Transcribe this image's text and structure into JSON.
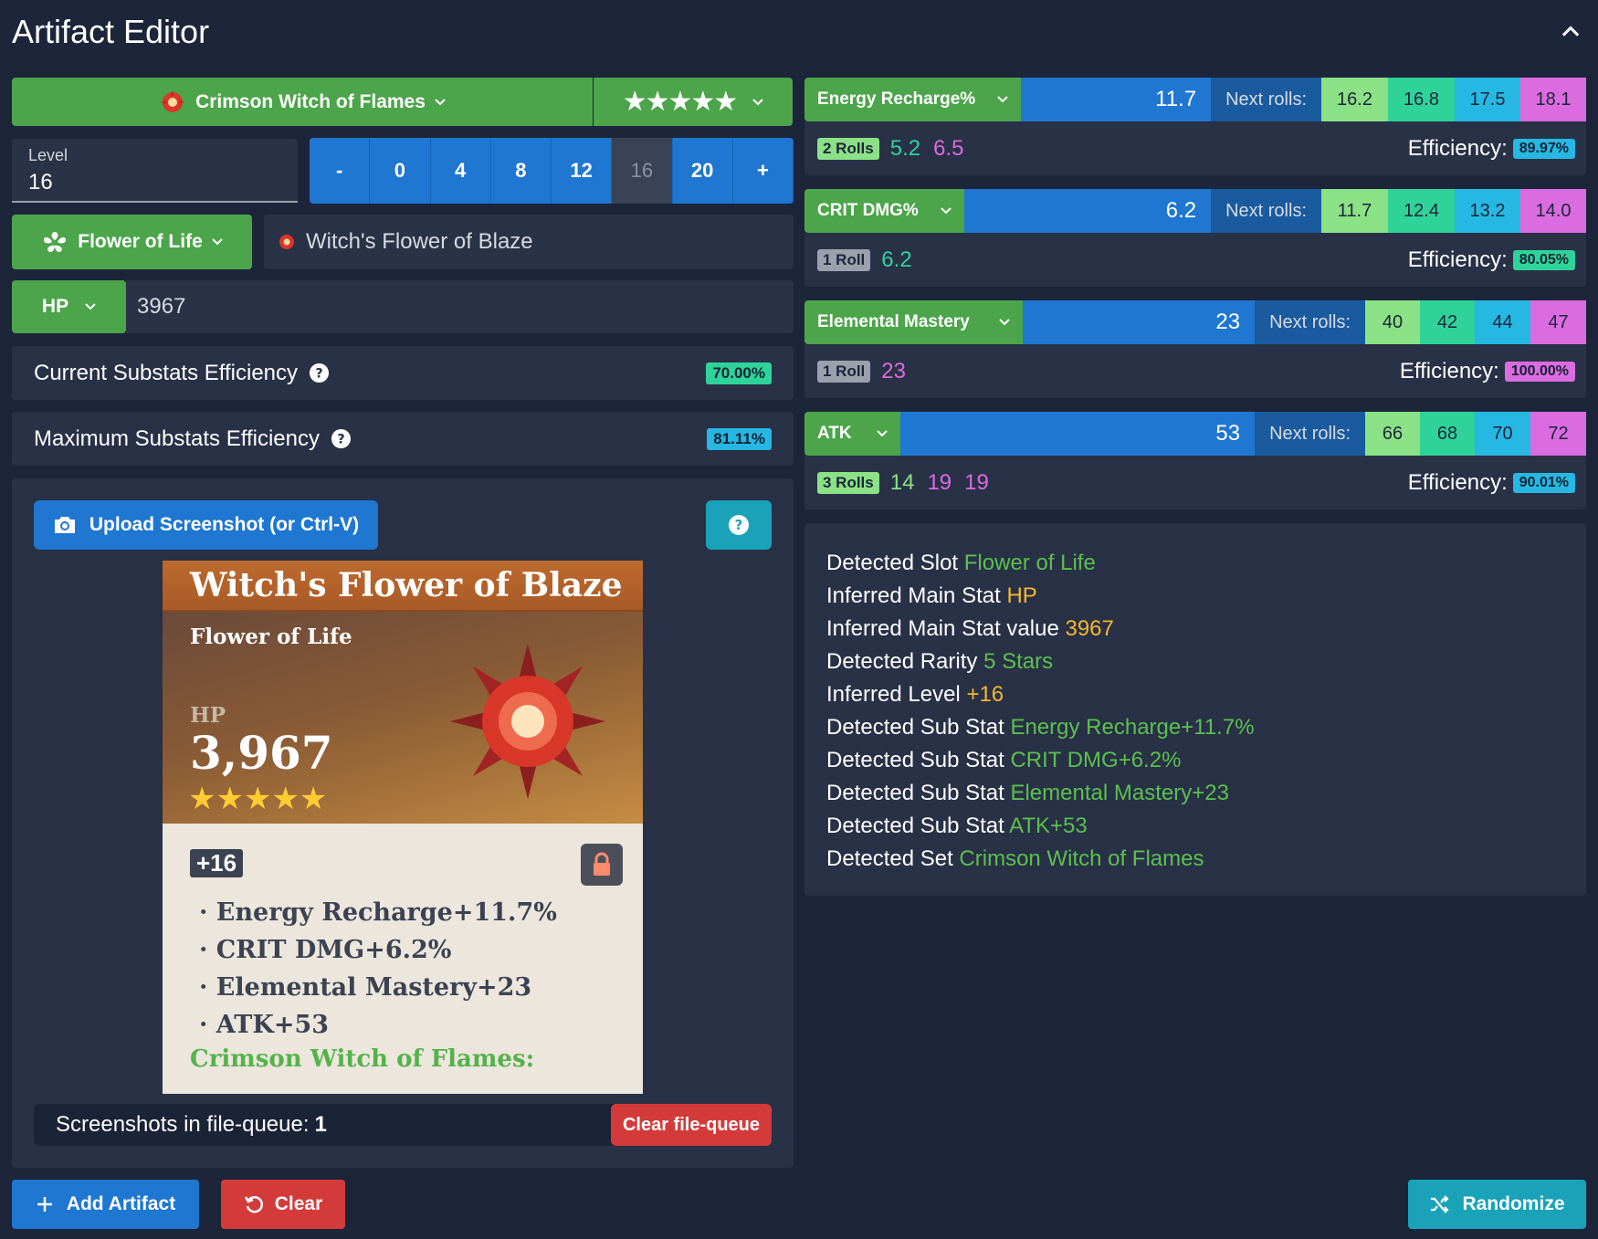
{
  "title": "Artifact Editor",
  "set": {
    "name": "Crimson Witch of Flames",
    "rarity_stars": 5
  },
  "level": {
    "label": "Level",
    "value": "16",
    "buttons": [
      "-",
      "0",
      "4",
      "8",
      "12",
      "16",
      "20",
      "+"
    ],
    "active": "16"
  },
  "slot": {
    "label": "Flower of Life",
    "piece_name": "Witch's Flower of Blaze"
  },
  "main_stat": {
    "key": "HP",
    "value": "3967"
  },
  "efficiency": {
    "current_label": "Current Substats Efficiency",
    "current_value": "70.00%",
    "max_label": "Maximum Substats Efficiency",
    "max_value": "81.11%"
  },
  "upload": {
    "button_label": "Upload Screenshot (or Ctrl-V)"
  },
  "card": {
    "title": "Witch's Flower of Blaze",
    "slot": "Flower of Life",
    "main_label": "HP",
    "main_value": "3,967",
    "level": "+16",
    "substats": [
      "· Energy Recharge+11.7%",
      "· CRIT DMG+6.2%",
      "· Elemental Mastery+23",
      "· ATK+53"
    ],
    "set": "Crimson Witch of Flames:"
  },
  "queue": {
    "label": "Screenshots in file-queue:",
    "count": "1",
    "clear_label": "Clear file-queue"
  },
  "actions": {
    "add": "Add Artifact",
    "clear": "Clear",
    "randomize": "Randomize"
  },
  "substats": [
    {
      "name": "Energy Recharge%",
      "value": "11.7",
      "next_label": "Next rolls:",
      "next": [
        "16.2",
        "16.8",
        "17.5",
        "18.1"
      ],
      "rolls_label": "2 Rolls",
      "roll_values": [
        "5.2",
        "6.5"
      ],
      "eff_label": "Efficiency:",
      "eff": "89.97%"
    },
    {
      "name": "CRIT DMG%",
      "value": "6.2",
      "next_label": "Next rolls:",
      "next": [
        "11.7",
        "12.4",
        "13.2",
        "14.0"
      ],
      "rolls_label": "1 Roll",
      "roll_values": [
        "6.2"
      ],
      "eff_label": "Efficiency:",
      "eff": "80.05%"
    },
    {
      "name": "Elemental Mastery",
      "value": "23",
      "next_label": "Next rolls:",
      "next": [
        "40",
        "42",
        "44",
        "47"
      ],
      "rolls_label": "1 Roll",
      "roll_values": [
        "23"
      ],
      "eff_label": "Efficiency:",
      "eff": "100.00%"
    },
    {
      "name": "ATK",
      "value": "53",
      "next_label": "Next rolls:",
      "next": [
        "66",
        "68",
        "70",
        "72"
      ],
      "rolls_label": "3 Rolls",
      "roll_values": [
        "14",
        "19",
        "19"
      ],
      "eff_label": "Efficiency:",
      "eff": "90.01%"
    }
  ],
  "detection": [
    {
      "label": "Detected Slot",
      "value": "Flower of Life"
    },
    {
      "label": "Inferred Main Stat",
      "value": "HP"
    },
    {
      "label": "Inferred Main Stat value",
      "value": "3967"
    },
    {
      "label": "Detected Rarity",
      "value": "5 Stars"
    },
    {
      "label": "Inferred Level",
      "value": "+16"
    },
    {
      "label": "Detected Sub Stat",
      "value": "Energy Recharge+11.7%"
    },
    {
      "label": "Detected Sub Stat",
      "value": "CRIT DMG+6.2%"
    },
    {
      "label": "Detected Sub Stat",
      "value": "Elemental Mastery+23"
    },
    {
      "label": "Detected Sub Stat",
      "value": "ATK+53"
    },
    {
      "label": "Detected Set",
      "value": "Crimson Witch of Flames"
    }
  ],
  "colors": {
    "green": "#4ca54a",
    "blue": "#1f77d1",
    "red": "#d33b3b",
    "teal": "#1aa2b8",
    "panel": "#283146",
    "bg": "#1c2539"
  }
}
